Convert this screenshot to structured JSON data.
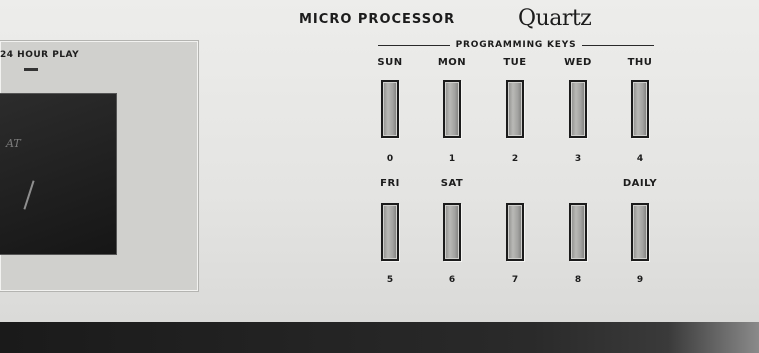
{
  "display": {
    "label": "24 HOUR PLAY",
    "screen_text": "AT"
  },
  "header": {
    "title": "MICRO PROCESSOR",
    "brand": "Quartz",
    "subtitle": "PROGRAMMING KEYS"
  },
  "keys": {
    "row1": [
      {
        "label": "SUN",
        "num": "0"
      },
      {
        "label": "MON",
        "num": "1"
      },
      {
        "label": "TUE",
        "num": "2"
      },
      {
        "label": "WED",
        "num": "3"
      },
      {
        "label": "THU",
        "num": "4"
      }
    ],
    "row2": [
      {
        "label": "FRI",
        "num": "5"
      },
      {
        "label": "SAT",
        "num": "6"
      },
      {
        "label": "",
        "num": "7"
      },
      {
        "label": "",
        "num": "8"
      },
      {
        "label": "DAILY",
        "num": "9"
      }
    ]
  },
  "colors": {
    "panel": "#e6e6e4",
    "key_face": "#b9b9b6",
    "key_border": "#1b1b1b",
    "screen": "#1c1c1c"
  }
}
